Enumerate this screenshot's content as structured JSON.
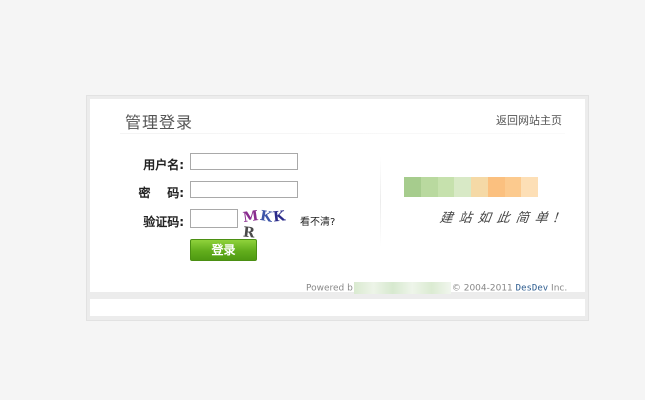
{
  "page": {
    "title": "管理登录",
    "home_link": "返回网站主页"
  },
  "form": {
    "username_label": "用户名:",
    "username_value": "",
    "password_label": "密    码:",
    "password_value": "",
    "captcha_label": "验证码:",
    "captcha_value": "",
    "captcha_text": "MKKR",
    "cant_see_label": "看不清?",
    "login_button": "登录"
  },
  "brand": {
    "slogan": "建站如此简单!",
    "strip_colors": [
      "#a6cc8d",
      "#b9d99f",
      "#c6e1ad",
      "#d8e9c6",
      "#f5d9a6",
      "#fbc07f",
      "#fcca8e",
      "#fddfb6"
    ]
  },
  "footer": {
    "powered_prefix": "Powered b",
    "copyright": "2004-2011",
    "brand_name": "DesDev",
    "suffix": "Inc."
  },
  "colors": {
    "button_green": "#62ad1c",
    "background": "#f5f5f5",
    "link_blue": "#2d5c8f"
  }
}
